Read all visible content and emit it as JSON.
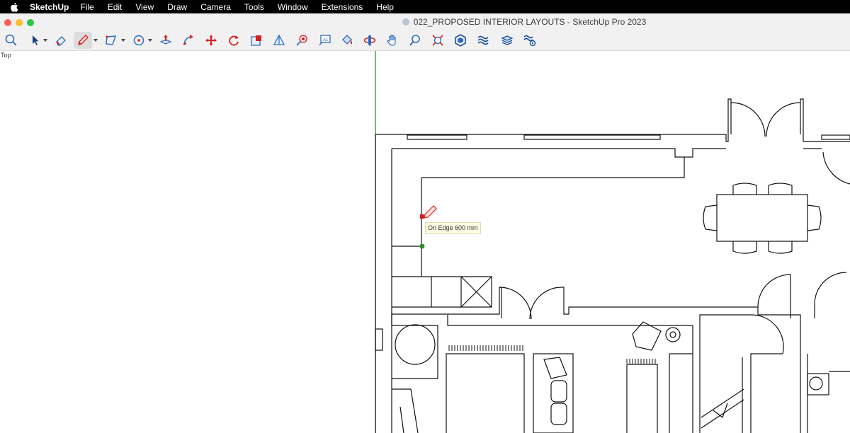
{
  "menubar": {
    "app": "SketchUp",
    "items": [
      "File",
      "Edit",
      "View",
      "Draw",
      "Camera",
      "Tools",
      "Window",
      "Extensions",
      "Help"
    ]
  },
  "window": {
    "title": "022_PROPOSED INTERIOR LAYOUTS - SketchUp Pro 2023"
  },
  "toolbar": {
    "tools": [
      "search",
      "select",
      "eraser",
      "pencil",
      "polygon",
      "circle",
      "push-pull",
      "follow-me",
      "move",
      "rotate",
      "scale",
      "section-plane",
      "point-marker",
      "text",
      "paint-bucket",
      "orbit",
      "pan",
      "zoom",
      "zoom-extents",
      "components",
      "layers",
      "outliner",
      "scenes"
    ],
    "active_tool": "pencil"
  },
  "viewport": {
    "view_label": "Top",
    "tooltip": "On Edge 600 mm"
  },
  "colors": {
    "accent_red": "#d62020",
    "accent_blue": "#2a6bc4",
    "axis_green": "#1a8a1a",
    "inference_green": "#2e8b2e"
  }
}
